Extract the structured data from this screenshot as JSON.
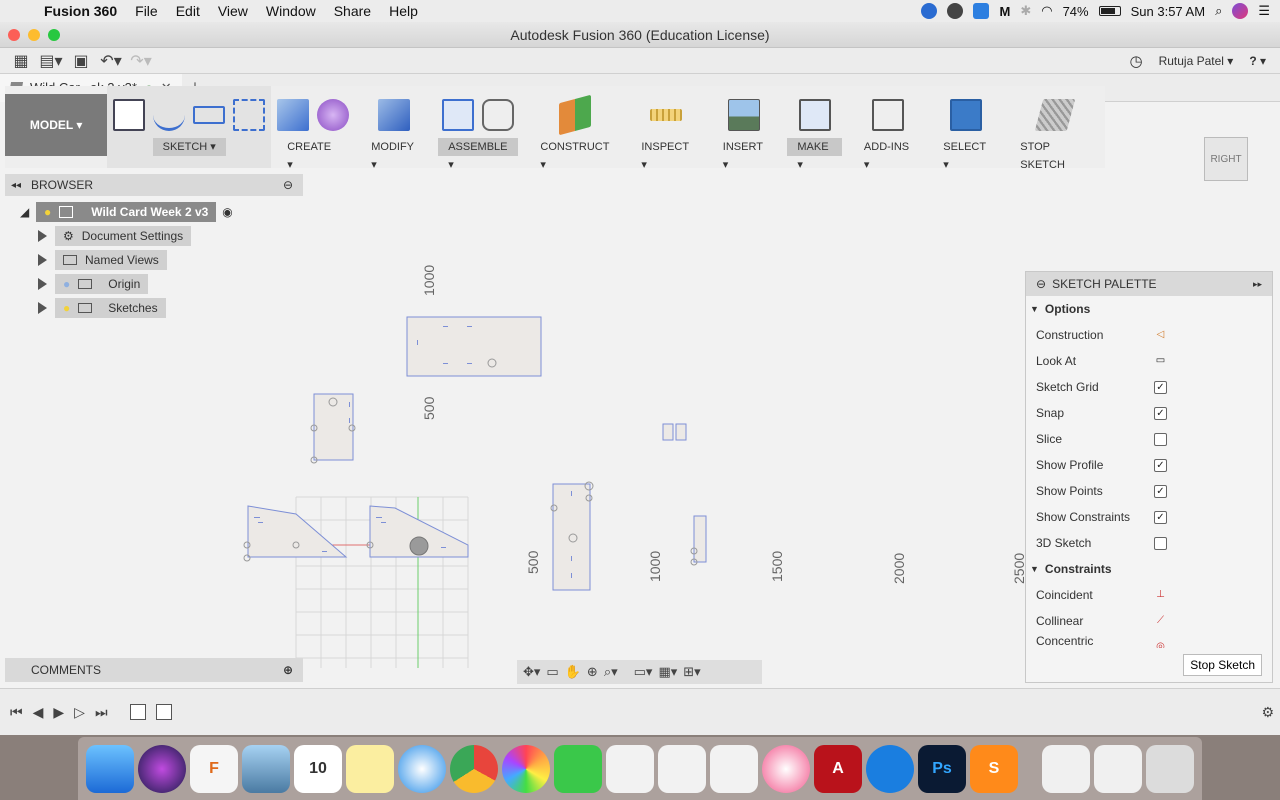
{
  "menubar": {
    "app_name": "Fusion 360",
    "items": [
      "File",
      "Edit",
      "View",
      "Window",
      "Share",
      "Help"
    ],
    "battery": "74%",
    "clock": "Sun 3:57 AM"
  },
  "window": {
    "title": "Autodesk Fusion 360 (Education License)"
  },
  "user": {
    "name": "Rutuja Patel ▾",
    "help": "? ▾"
  },
  "tab": {
    "label": "Wild Car...ek 2 v3*"
  },
  "ribbon": {
    "mode": "MODEL ▾",
    "groups": [
      "SKETCH ▾",
      "CREATE ▾",
      "MODIFY ▾",
      "ASSEMBLE ▾",
      "CONSTRUCT ▾",
      "INSPECT ▾",
      "INSERT ▾",
      "MAKE ▾",
      "ADD-INS ▾",
      "SELECT ▾",
      "STOP SKETCH"
    ]
  },
  "viewcube": {
    "face": "RIGHT"
  },
  "browser": {
    "title": "BROWSER",
    "root": "Wild Card Week 2 v3",
    "items": [
      "Document Settings",
      "Named Views",
      "Origin",
      "Sketches"
    ]
  },
  "comments": {
    "title": "COMMENTS"
  },
  "axis_labels": [
    "1000",
    "500",
    "500",
    "1000",
    "1500",
    "2000",
    "2500"
  ],
  "palette": {
    "title": "SKETCH PALETTE",
    "options_title": "Options",
    "options": [
      {
        "label": "Construction",
        "control": "◁"
      },
      {
        "label": "Look At",
        "control": "▭"
      },
      {
        "label": "Sketch Grid",
        "control": "✓"
      },
      {
        "label": "Snap",
        "control": "✓"
      },
      {
        "label": "Slice",
        "control": ""
      },
      {
        "label": "Show Profile",
        "control": "✓"
      },
      {
        "label": "Show Points",
        "control": "✓"
      },
      {
        "label": "Show Constraints",
        "control": "✓"
      },
      {
        "label": "3D Sketch",
        "control": ""
      }
    ],
    "constraints_title": "Constraints",
    "constraints": [
      {
        "label": "Coincident",
        "control": "⊥"
      },
      {
        "label": "Collinear",
        "control": "⟋"
      },
      {
        "label": "Concentric",
        "control": "◎"
      }
    ],
    "stop_button": "Stop Sketch"
  }
}
